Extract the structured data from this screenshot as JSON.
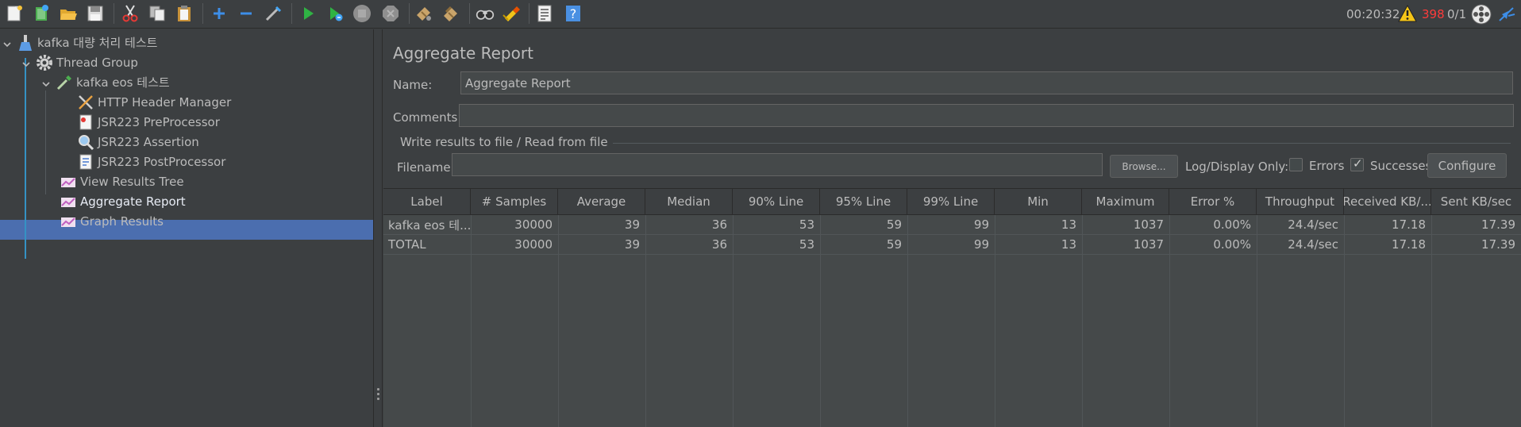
{
  "toolbar": {
    "icons": [
      "new-icon",
      "templates-icon",
      "open-icon",
      "save-icon",
      "cut-icon",
      "copy-icon",
      "paste-icon",
      "expand-icon",
      "collapse-icon",
      "toggle-icon",
      "start-icon",
      "start-no-pause-icon",
      "stop-icon",
      "shutdown-icon",
      "clear-icon",
      "clear-all-icon",
      "search-icon",
      "reset-search-icon",
      "function-helper-icon",
      "help-icon"
    ],
    "timer": "00:20:32",
    "error_count": "398",
    "threads": "0/1"
  },
  "tree": {
    "nodes": [
      {
        "label": "kafka 대량 처리 테스트",
        "icon": "test-plan-icon"
      },
      {
        "label": "Thread Group",
        "icon": "gear-icon"
      },
      {
        "label": "kafka eos 테스트",
        "icon": "pipette-sampler-icon"
      },
      {
        "label": "HTTP Header Manager",
        "icon": "wrench-icon"
      },
      {
        "label": "JSR223 PreProcessor",
        "icon": "preprocessor-icon"
      },
      {
        "label": "JSR223 Assertion",
        "icon": "magnifier-assertion-icon"
      },
      {
        "label": "JSR223 PostProcessor",
        "icon": "postprocessor-icon"
      },
      {
        "label": "View Results Tree",
        "icon": "listener-chart-icon"
      },
      {
        "label": "Aggregate Report",
        "icon": "listener-chart-icon"
      },
      {
        "label": "Graph Results",
        "icon": "listener-chart-icon"
      }
    ],
    "selected": "Aggregate Report"
  },
  "panel": {
    "title": "Aggregate Report",
    "name_label": "Name:",
    "name_value": "Aggregate Report",
    "comments_label": "Comments:",
    "comments_value": "",
    "group_title": "Write results to file / Read from file",
    "filename_label": "Filename",
    "filename_value": "",
    "browse_label": "Browse...",
    "log_display_label": "Log/Display Only:",
    "errors_label": "Errors",
    "errors_checked": false,
    "successes_label": "Successes",
    "successes_checked": true,
    "configure_label": "Configure"
  },
  "table": {
    "headers": [
      "Label",
      "# Samples",
      "Average",
      "Median",
      "90% Line",
      "95% Line",
      "99% Line",
      "Min",
      "Maximum",
      "Error %",
      "Throughput",
      "Received KB/...",
      "Sent KB/sec"
    ],
    "rows": [
      [
        "kafka eos 테...",
        "30000",
        "39",
        "36",
        "53",
        "59",
        "99",
        "13",
        "1037",
        "0.00%",
        "24.4/sec",
        "17.18",
        "17.39"
      ],
      [
        "TOTAL",
        "30000",
        "39",
        "36",
        "53",
        "59",
        "99",
        "13",
        "1037",
        "0.00%",
        "24.4/sec",
        "17.18",
        "17.39"
      ]
    ]
  },
  "colors": {
    "background": "#3c3f41",
    "selection": "#4b6eaf",
    "error_red": "#ff3b3b",
    "tree_line": "#3592c4"
  }
}
